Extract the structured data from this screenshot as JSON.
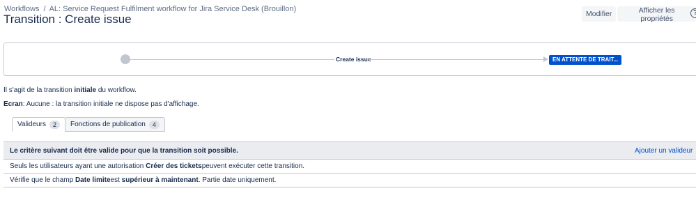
{
  "breadcrumb": {
    "workflows": "Workflows",
    "separator": "/",
    "workflow_name": "AL: Service Request Fulfilment workflow for Jira Service Desk (Brouillon)"
  },
  "page_title": "Transition : Create issue",
  "actions": {
    "edit_label": "Modifier",
    "properties_label": "Afficher les propriétés",
    "help_icon": "help-icon",
    "help_glyph": "?"
  },
  "diagram": {
    "transition_label": "Create issue",
    "status_label": "EN ATTENTE DE TRAIT..."
  },
  "description": {
    "line1_prefix": "Il s'agit de la transition ",
    "line1_bold": "initiale",
    "line1_suffix": " du workflow.",
    "line2_bold": "Ecran",
    "line2_rest": ": Aucune : la transition initiale ne dispose pas d'affichage."
  },
  "tabs": [
    {
      "label": "Valideurs",
      "count": "2",
      "active": true
    },
    {
      "label": "Fonctions de publication",
      "count": "4",
      "active": false
    }
  ],
  "validators": {
    "header": "Le critère suivant doit être valide pour que la transition soit possible.",
    "add_link": "Ajouter un valideur",
    "rows": [
      {
        "prefix": "Seuls les utilisateurs ayant une autorisation ",
        "bold1": "Créer des tickets",
        "suffix": " peuvent exécuter cette transition."
      },
      {
        "prefix": "Vérifie que le champ ",
        "bold1": "Date limite",
        "middle": " est ",
        "bold2": "supérieur à maintenant",
        "suffix": ". Partie date uniquement."
      }
    ]
  },
  "colors": {
    "accent": "#0052cc",
    "text": "#172b4d",
    "panel_header_bg": "#ebecf0",
    "border": "#c1c7d0"
  }
}
